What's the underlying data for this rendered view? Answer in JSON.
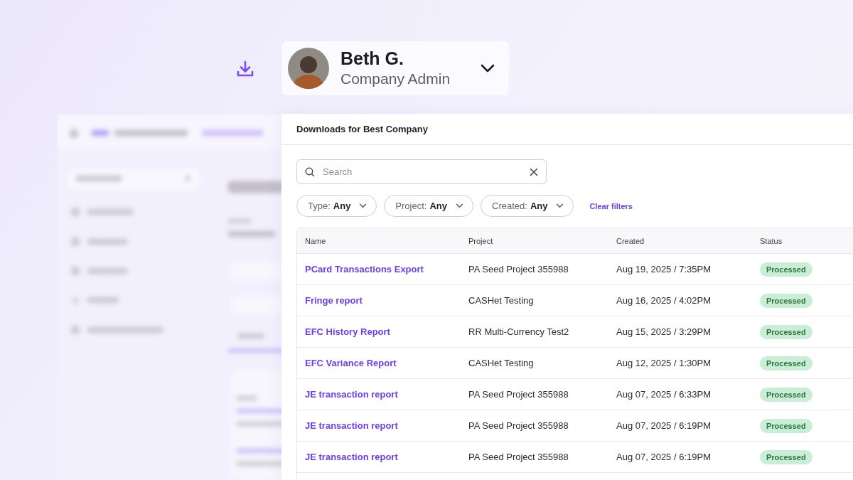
{
  "user": {
    "name": "Beth G.",
    "role": "Company Admin"
  },
  "downloads": {
    "title": "Downloads for Best Company",
    "search": {
      "placeholder": "Search"
    },
    "filters": [
      {
        "label": "Type:",
        "value": "Any"
      },
      {
        "label": "Project:",
        "value": "Any"
      },
      {
        "label": "Created:",
        "value": "Any"
      }
    ],
    "clear_filters": "Clear filters",
    "table": {
      "columns": [
        "Name",
        "Project",
        "Created",
        "Status"
      ],
      "rows": [
        {
          "name": "PCard Transactions Export",
          "project": "PA Seed Project 355988",
          "created": "Aug 19, 2025 / 7:35PM",
          "status": "Processed"
        },
        {
          "name": "Fringe report",
          "project": "CASHet Testing",
          "created": "Aug 16, 2025 / 4:02PM",
          "status": "Processed"
        },
        {
          "name": "EFC History Report",
          "project": "RR Multi-Currency Test2",
          "created": "Aug 15, 2025 / 3:29PM",
          "status": "Processed"
        },
        {
          "name": "EFC Variance Report",
          "project": "CASHet Testing",
          "created": "Aug 12, 2025 / 1:30PM",
          "status": "Processed"
        },
        {
          "name": "JE transaction report",
          "project": "PA Seed Project 355988",
          "created": "Aug 07, 2025 / 6:33PM",
          "status": "Processed"
        },
        {
          "name": "JE transaction report",
          "project": "PA Seed Project 355988",
          "created": "Aug 07, 2025 / 6:19PM",
          "status": "Processed"
        },
        {
          "name": "JE transaction report",
          "project": "PA Seed Project 355988",
          "created": "Aug 07, 2025 / 6:19PM",
          "status": "Processed"
        }
      ]
    }
  }
}
